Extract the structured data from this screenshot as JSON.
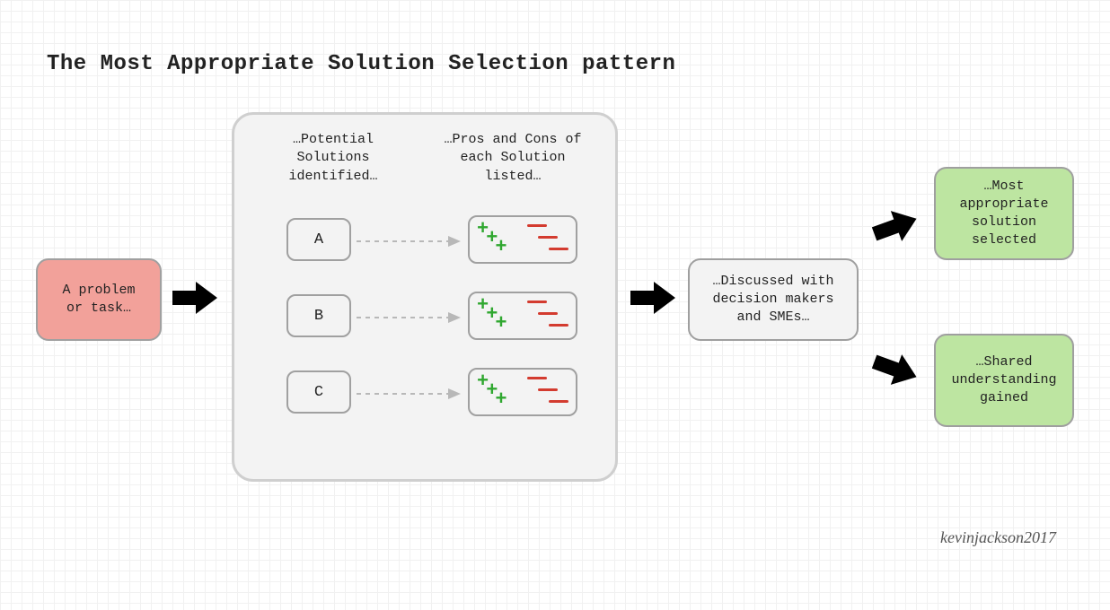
{
  "title": "The Most Appropriate Solution Selection pattern",
  "problem_box": "A problem or task…",
  "panel": {
    "col1_label": "…Potential Solutions identified…",
    "col2_label": "…Pros and Cons of each Solution listed…",
    "solutions": {
      "a": "A",
      "b": "B",
      "c": "C"
    }
  },
  "discussed_box": "…Discussed with decision makers and SMEs…",
  "output1": "…Most appropriate solution selected",
  "output2": "…Shared understanding gained",
  "credit": "kevinjackson2017",
  "colors": {
    "red": "#f2a19a",
    "green": "#bde5a1",
    "plus": "#2fa72f",
    "minus": "#d33b2f",
    "arrow": "#000000",
    "dash": "#b8b8b8"
  }
}
